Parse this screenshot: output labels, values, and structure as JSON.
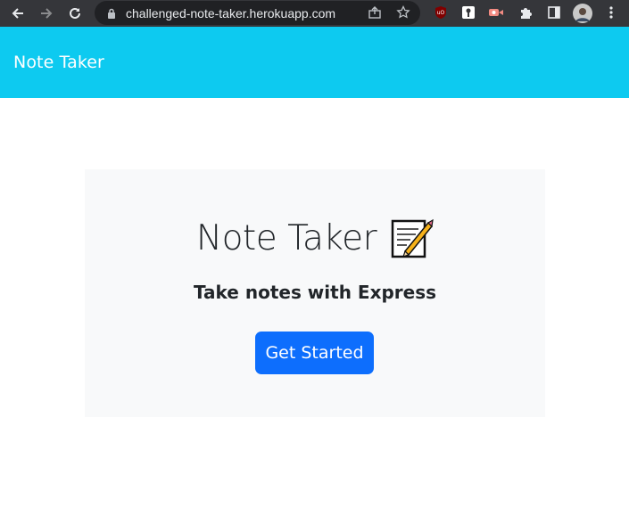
{
  "browser": {
    "url": "challenged-note-taker.herokuapp.com",
    "icons": [
      "back-icon",
      "forward-icon",
      "reload-icon",
      "lock-icon",
      "share-icon",
      "bookmark-star-icon",
      "ublock-extension-icon",
      "bitwarden-extension-icon",
      "screencast-extension-icon",
      "extensions-puzzle-icon",
      "side-panel-icon",
      "profile-avatar",
      "more-menu-icon"
    ]
  },
  "navbar": {
    "brand": "Note Taker",
    "color": "#0dcaf0"
  },
  "hero": {
    "title": "Note Taker",
    "icon": "memo-icon",
    "lead": "Take notes with Express",
    "button_label": "Get Started",
    "button_color": "#0d6efd"
  }
}
